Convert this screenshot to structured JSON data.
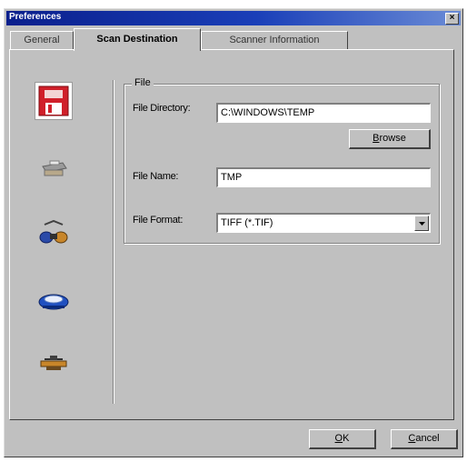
{
  "window": {
    "title": "Preferences",
    "close_glyph": "×"
  },
  "tabs": [
    {
      "label": "General",
      "active": false
    },
    {
      "label": "Scan Destination",
      "active": true
    },
    {
      "label": "Scanner Information",
      "active": false
    }
  ],
  "destinations": [
    {
      "icon": "file-save-icon",
      "selected": true
    },
    {
      "icon": "printer-icon",
      "selected": false
    },
    {
      "icon": "application-icon",
      "selected": false
    },
    {
      "icon": "email-icon",
      "selected": false
    },
    {
      "icon": "fax-icon",
      "selected": false
    }
  ],
  "file_group": {
    "legend": "File",
    "directory_label": "File Directory:",
    "directory_value": "C:\\WINDOWS\\TEMP",
    "browse": {
      "pre": "",
      "accel": "B",
      "post": "rowse"
    },
    "name_label": "File Name:",
    "name_value": "TMP",
    "format_label": "File Format:",
    "format_value": "TIFF (*.TIF)"
  },
  "buttons": {
    "ok": {
      "pre": "",
      "accel": "O",
      "post": "K"
    },
    "cancel": {
      "pre": "",
      "accel": "C",
      "post": "ancel"
    }
  },
  "colors": {
    "titlebar": "#0a1f8c",
    "face": "#c0c0c0",
    "selected_icon": "#d0202a"
  }
}
